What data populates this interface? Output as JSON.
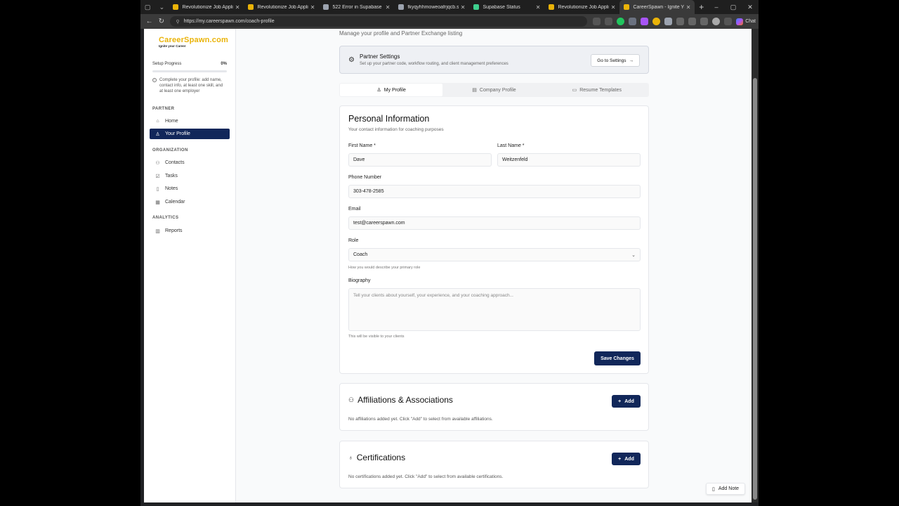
{
  "browser": {
    "tabs": [
      {
        "title": "Revolutionize Job Applicatio",
        "color": "#eab308",
        "active": false
      },
      {
        "title": "Revolutionize Job Applicatio",
        "color": "#eab308",
        "active": false
      },
      {
        "title": "522 Error in Supabase",
        "color": "#9ca3af",
        "active": false
      },
      {
        "title": "fkyqyhhmoweoafrjqcb.supa",
        "color": "#9ca3af",
        "active": false
      },
      {
        "title": "Supabase Status",
        "color": "#3ecf8e",
        "active": false
      },
      {
        "title": "Revolutionize Job Applicatio",
        "color": "#eab308",
        "active": false
      },
      {
        "title": "CareerSpawn - Ignite Your S",
        "color": "#eab308",
        "active": true
      }
    ],
    "url": "https://my.careerspawn.com/coach-profile",
    "chat_label": "Chat"
  },
  "sidebar": {
    "logo_name": "CareerSpawn.com",
    "logo_tagline": "Ignite your Career",
    "setup": {
      "label": "Setup Progress",
      "percent_text": "0%",
      "progress": 0,
      "hint": "Complete your profile: add name, contact info, at least one skill, and at least one employer"
    },
    "sections": {
      "partner": "PARTNER",
      "organization": "ORGANIZATION",
      "analytics": "ANALYTICS"
    },
    "items": {
      "home": "Home",
      "profile": "Your Profile",
      "contacts": "Contacts",
      "tasks": "Tasks",
      "notes": "Notes",
      "calendar": "Calendar",
      "reports": "Reports"
    }
  },
  "main": {
    "subtitle": "Manage your profile and Partner Exchange listing",
    "partner_settings": {
      "title": "Partner Settings",
      "description": "Set up your partner code, workflow routing, and client management preferences",
      "button": "Go to Settings"
    },
    "tabs": {
      "my_profile": "My Profile",
      "company_profile": "Company Profile",
      "resume_templates": "Resume Templates"
    },
    "personal": {
      "title": "Personal Information",
      "subtitle": "Your contact information for coaching purposes",
      "first_name_label": "First Name *",
      "first_name": "Dave",
      "last_name_label": "Last Name *",
      "last_name": "Weitzenfeld",
      "phone_label": "Phone Number",
      "phone": "303-478-2585",
      "email_label": "Email",
      "email": "test@careerspawn.com",
      "role_label": "Role",
      "role": "Coach",
      "role_help": "How you would describe your primary role",
      "bio_label": "Biography",
      "bio_placeholder": "Tell your clients about yourself, your experience, and your coaching approach...",
      "bio_help": "This will be visible to your clients",
      "save": "Save Changes"
    },
    "affiliations": {
      "title": "Affiliations & Associations",
      "add": "Add",
      "empty": "No affiliations added yet. Click \"Add\" to select from available affiliations."
    },
    "certifications": {
      "title": "Certifications",
      "add": "Add",
      "empty": "No certifications added yet. Click \"Add\" to select from available certifications."
    },
    "add_note": "Add Note"
  },
  "colors": {
    "accent": "#11275a",
    "brand": "#eab308"
  }
}
